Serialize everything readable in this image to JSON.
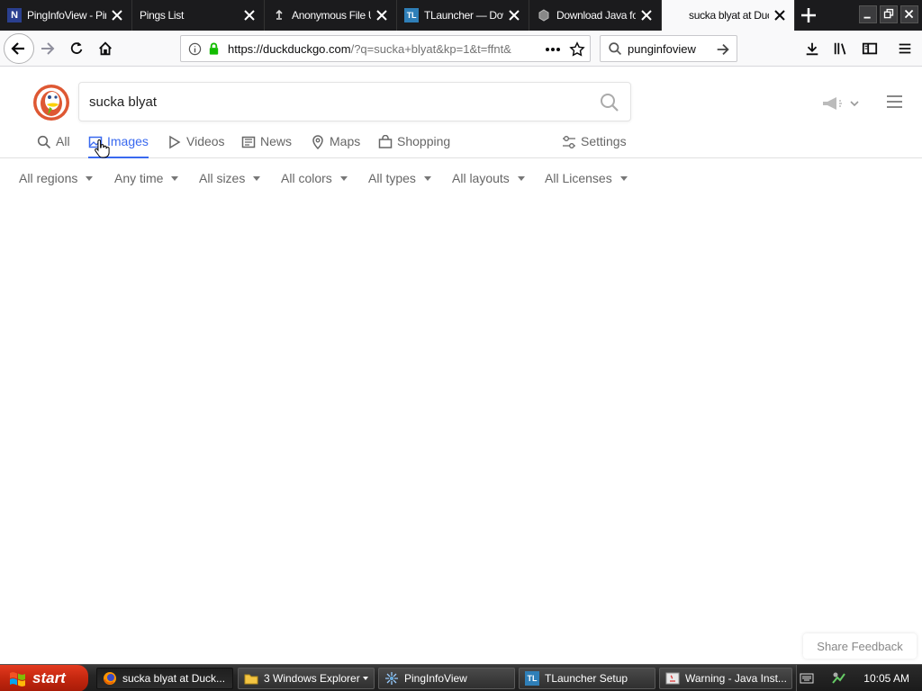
{
  "browser": {
    "tabs": [
      {
        "title": "PingInfoView - Pin",
        "icon": "n-favicon"
      },
      {
        "title": "Pings List",
        "icon": "blank"
      },
      {
        "title": "Anonymous File Up",
        "icon": "file-upload-favicon"
      },
      {
        "title": "TLauncher — Dow",
        "icon": "tlauncher-favicon"
      },
      {
        "title": "Download Java fo",
        "icon": "java-favicon"
      },
      {
        "title": "sucka blyat at Duc",
        "icon": "blank",
        "active": true
      }
    ],
    "url": {
      "host": "https://duckduckgo.com",
      "path": "/?q=sucka+blyat&kp=1&t=ffnt&"
    },
    "search_box": "punginfoview"
  },
  "ddg": {
    "query": "sucka blyat",
    "tabs": [
      "All",
      "Images",
      "Videos",
      "News",
      "Maps",
      "Shopping"
    ],
    "active_tab": "Images",
    "settings_label": "Settings",
    "filters": [
      "All regions",
      "Any time",
      "All sizes",
      "All colors",
      "All types",
      "All layouts",
      "All Licenses"
    ],
    "share_feedback": "Share Feedback",
    "accent": "#3969ef",
    "logo_color": "#de5833"
  },
  "taskbar": {
    "start": "start",
    "items": [
      {
        "label": "sucka blyat at Duck...",
        "icon": "firefox-icon",
        "active": true
      },
      {
        "label": "3 Windows Explorer",
        "icon": "folder-icon",
        "group": true
      },
      {
        "label": "PingInfoView",
        "icon": "pinginfoview-icon"
      },
      {
        "label": "TLauncher Setup",
        "icon": "tlauncher-icon"
      },
      {
        "label": "Warning - Java Inst...",
        "icon": "java-warning-icon"
      }
    ],
    "clock": "10:05 AM"
  }
}
